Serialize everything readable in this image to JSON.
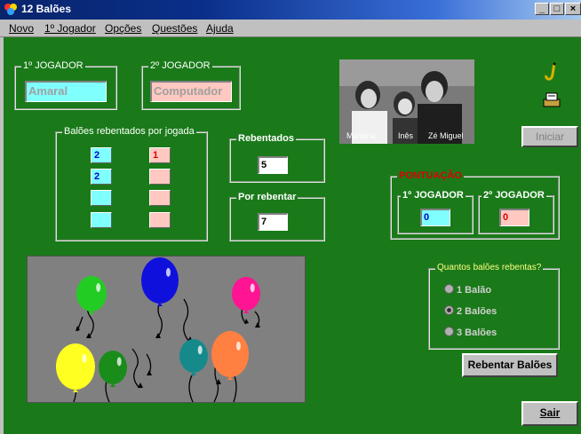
{
  "window": {
    "title": "12 Balões",
    "controls": [
      "_",
      "□",
      "×"
    ]
  },
  "menu": [
    "Novo",
    "1º Jogador",
    "Opções",
    "Questões",
    "Ajuda"
  ],
  "player1": {
    "legend": "1º JOGADOR",
    "name": "Amaral"
  },
  "player2": {
    "legend": "2º JOGADOR",
    "name": "Computador"
  },
  "per_play": {
    "legend": "Balões rebentados por jogada",
    "player1_values": [
      "2",
      "2",
      "",
      ""
    ],
    "player2_values": [
      "1",
      "",
      "",
      ""
    ]
  },
  "rebentados": {
    "legend": "Rebentados",
    "value": "5"
  },
  "por_rebentar": {
    "legend": "Por rebentar",
    "value": "7"
  },
  "photo": {
    "names": [
      "Mariana",
      "Inês",
      "Zé Miguel"
    ]
  },
  "iniciar_label": "Iniciar",
  "pontuacao": {
    "legend": "PONTUAÇÃO",
    "p1_legend": "1º JOGADOR",
    "p1_value": "0",
    "p2_legend": "2º JOGADOR",
    "p2_value": "0"
  },
  "quantos": {
    "legend": "Quantos balões rebentas?",
    "options": [
      "1 Balão",
      "2 Balões",
      "3 Balões"
    ]
  },
  "rebentar_label": "Rebentar Balões",
  "sair_label": "Sair",
  "balloon_colors": [
    "#22cc22",
    "#1010dd",
    "#ff1493",
    "#ffff22",
    "#1a8c1a",
    "#168a8a",
    "#ff8040"
  ],
  "colors": {
    "green_bg": "#1a7a1a",
    "cyan_field": "#80ffff",
    "pink_field": "#ffc8c0",
    "pontuacao_red": "#e00000"
  }
}
